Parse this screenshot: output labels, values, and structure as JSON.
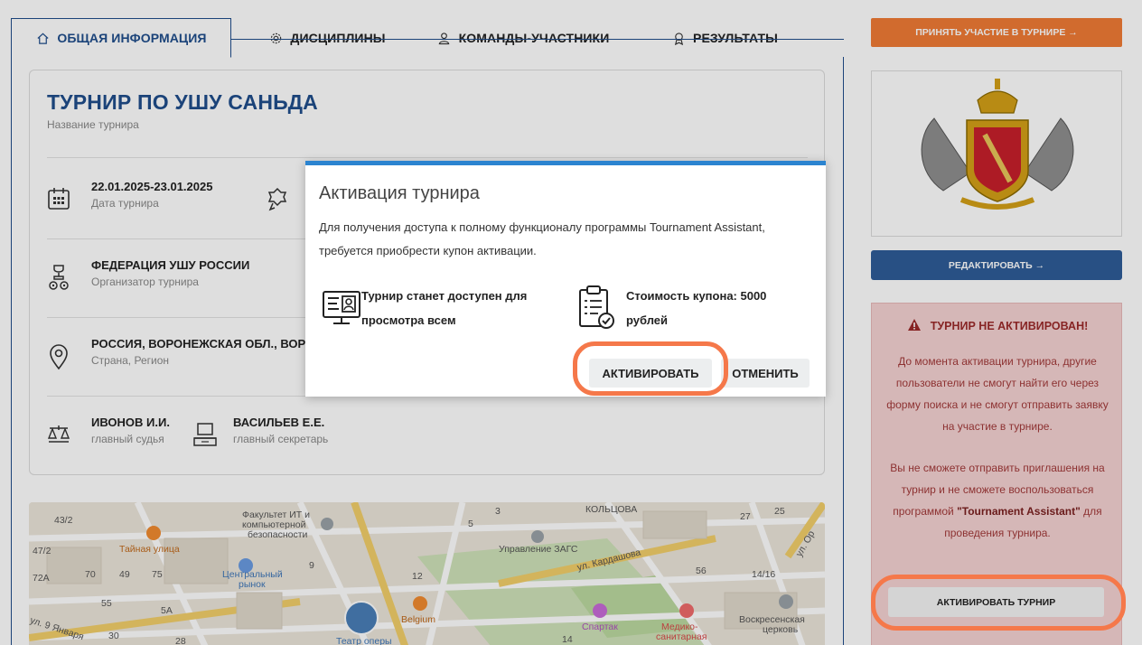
{
  "tabs": [
    {
      "label": "ОБЩАЯ ИНФОРМАЦИЯ",
      "icon": "home-icon",
      "active": true
    },
    {
      "label": "ДИСЦИПЛИНЫ",
      "icon": "gear-icon"
    },
    {
      "label": "КОМАНДЫ-УЧАСТНИКИ",
      "icon": "user-icon"
    },
    {
      "label": "РЕЗУЛЬТАТЫ",
      "icon": "award-icon"
    }
  ],
  "tournament": {
    "title": "ТУРНИР ПО УШУ САНЬДА",
    "title_label": "Название турнира",
    "dates": "22.01.2025-23.01.2025",
    "dates_label": "Дата турнира",
    "organizer": "ФЕДЕРАЦИЯ УШУ РОССИИ",
    "organizer_label": "Организатор турнира",
    "location": "РОССИЯ, ВОРОНЕЖСКАЯ ОБЛ., ВОР",
    "location_label": "Страна, Регион",
    "judge": "ИВОНОВ И.И.",
    "judge_label": "главный судья",
    "secretary": "ВАСИЛЬЕВ Е.Е.",
    "secretary_label": "главный секретарь"
  },
  "map": {
    "labels": [
      "43/2",
      "Факультет ИТ и",
      "компьютерной",
      "безопасности",
      "Тайная улица",
      "47/2",
      "Центральный",
      "рынок",
      "72А",
      "70",
      "49",
      "75",
      "9",
      "12",
      "5",
      "3",
      "27",
      "25",
      "КОЛЬЦОВА",
      "Управление ЗАГС",
      "ул. Кардашова",
      "56",
      "14/16",
      "55",
      "5А",
      "Belgium",
      "Спартак",
      "Медико-",
      "санитарная",
      "Воскресенская",
      "церковь",
      "ул. 9 Января",
      "30",
      "28",
      "Театр оперы",
      "ул. Ор",
      "14"
    ]
  },
  "right": {
    "join_label": "ПРИНЯТЬ УЧАСТИЕ В ТУРНИРЕ →",
    "edit_label": "РЕДАКТИРОВАТЬ →",
    "alert_title": "ТУРНИР НЕ АКТИВИРОВАН!",
    "alert_p1": "До момента активации турнира, другие пользователи не смогут найти его через форму поиска и не смогут отправить заявку на участие в турнире.",
    "alert_p2_a": "Вы не сможете отправить приглашения на турнир и не сможете воспользоваться программой",
    "alert_p2_b": "\"Tournament Assistant\"",
    "alert_p2_c": "для проведения турнира.",
    "activate_label": "АКТИВИРОВАТЬ ТУРНИР"
  },
  "modal": {
    "title": "Активация турнира",
    "description": "Для получения доступа к полному функционалу программы Tournament Assistant, требуется приобрести купон активации.",
    "feature1": "Турнир станет доступен для просмотра всем",
    "feature2": "Стоимость купона: 5000 рублей",
    "activate_label": "АКТИВИРОВАТЬ",
    "cancel_label": "ОТМЕНИТЬ"
  },
  "colors": {
    "accent_blue": "#1f4e8c",
    "orange": "#f07b35",
    "alert_bg": "#f5d3d3",
    "highlight": "#f5784a",
    "modal_top": "#2b84d0"
  }
}
